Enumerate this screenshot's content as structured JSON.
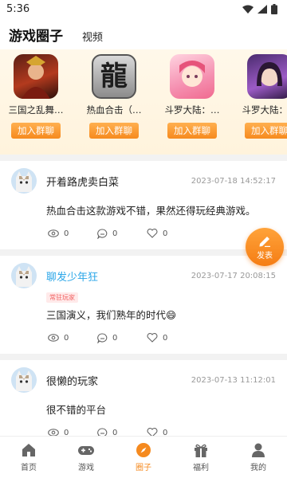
{
  "status": {
    "time": "5:36"
  },
  "header": {
    "tab_active": "游戏圈子",
    "tab_other": "视频"
  },
  "games": [
    {
      "name": "三国之乱舞…",
      "join": "加入群聊"
    },
    {
      "name": "热血合击（…",
      "join": "加入群聊",
      "icon_char": "龍"
    },
    {
      "name": "斗罗大陆：…",
      "join": "加入群聊"
    },
    {
      "name": "斗罗大陆：…",
      "join": "加入群聊"
    }
  ],
  "posts": [
    {
      "author": "开着路虎卖白菜",
      "time": "2023-07-18 14:52:17",
      "content": "热血合击这款游戏不错，果然还得玩经典游戏。",
      "views": "0",
      "comments": "0",
      "likes": "0"
    },
    {
      "author": "聊发少年狂",
      "badge": "常驻玩家",
      "time": "2023-07-17 20:08:15",
      "content": "三国演义，我们熟年的时代😄",
      "views": "0",
      "comments": "0",
      "likes": "0"
    },
    {
      "author": "很懒的玩家",
      "time": "2023-07-13 11:12:01",
      "content": "很不错的平台",
      "views": "0",
      "comments": "0",
      "likes": "0"
    }
  ],
  "fab": {
    "label": "发表"
  },
  "tabbar": [
    {
      "label": "首页"
    },
    {
      "label": "游戏"
    },
    {
      "label": "圈子"
    },
    {
      "label": "福利"
    },
    {
      "label": "我的"
    }
  ],
  "colors": {
    "accent": "#f58a1f",
    "vip_name": "#2aa6e8",
    "badge": "#f26262"
  }
}
